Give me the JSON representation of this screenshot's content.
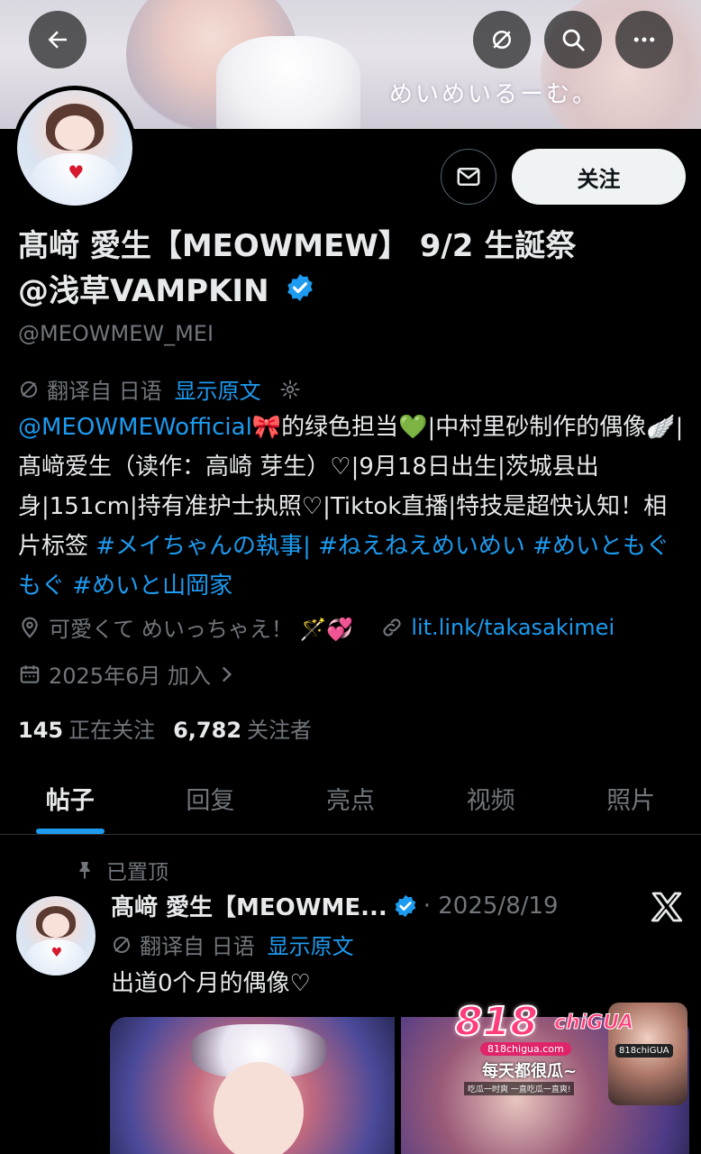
{
  "banner": {
    "caption": "めいめいるーむ。"
  },
  "header": {
    "back_icon": "arrow-left-icon",
    "mute_icon": "translate-off-icon",
    "search_icon": "search-icon",
    "more_icon": "more-horizontal-icon"
  },
  "profile": {
    "name_line1": "髙﨑 愛生【MEOWMEW】 9/2 生誕祭",
    "name_line2": "@浅草VAMPKIN",
    "handle": "@MEOWMEW_MEI",
    "message_icon": "mail-icon",
    "follow_label": "关注",
    "translate_prefix": "翻译自 日语",
    "translate_link": "显示原文",
    "bio": {
      "seg1": "@MEOWMEWofficial",
      "seg2": "🎀的绿色担当💚|中村里砂制作的偶像🪽|髙﨑爱生（读作：高崎 芽生）♡|9月18日出生|茨城县出身|151cm|持有准护士执照♡|Tiktok直播|特技是超快认知！相片标签 ",
      "tag1": "#メイちゃんの執事",
      "sep": "| ",
      "tag2": "#ねえねえめいめい",
      "space1": " ",
      "tag3": "#めいともぐもぐ",
      "space2": " ",
      "tag4": "#めいと山岡家"
    },
    "location": "可愛くて めいっちゃえ！ 🪄💞",
    "link": "lit.link/takasakimei",
    "joined": "2025年6月 加入",
    "following_count": "145",
    "following_label": "正在关注",
    "followers_count": "6,782",
    "followers_label": "关注者"
  },
  "tabs": [
    "帖子",
    "回复",
    "亮点",
    "视频",
    "照片"
  ],
  "post": {
    "pinned_label": "已置顶",
    "author": "髙﨑 愛生【MEOWME...",
    "date": "· 2025/8/19",
    "translate_prefix": "翻译自 日语",
    "translate_link": "显示原文",
    "text": "出道0个月的偶像♡"
  },
  "ad": {
    "logo": "818",
    "logo_suffix": "chiGUA",
    "url": "818chigua.com",
    "slogan": "每天都很瓜~",
    "sub": "吃瓜一时爽 一直吃瓜一直爽!",
    "badge": "818chiGUA"
  },
  "colors": {
    "accent": "#1d9bf0",
    "background": "#000000",
    "muted": "#71767b",
    "text": "#e7e9ea"
  }
}
